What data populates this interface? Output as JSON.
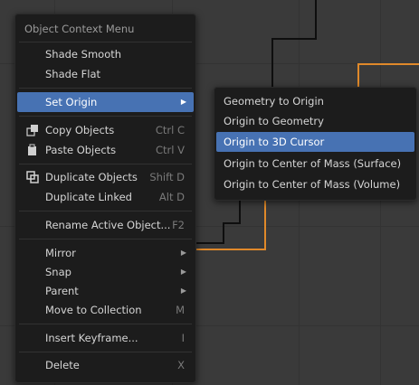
{
  "colors": {
    "menu_background": "#1c1c1c",
    "highlight": "#4772b3",
    "text": "#d5d5d5",
    "shortcut_text": "#7a7a7a",
    "selection_outline": "#e0892a"
  },
  "context_menu": {
    "title": "Object Context Menu",
    "items": {
      "shade_smooth": {
        "label": "Shade Smooth"
      },
      "shade_flat": {
        "label": "Shade Flat"
      },
      "set_origin": {
        "label": "Set Origin",
        "submenu": true
      },
      "copy_objects": {
        "label": "Copy Objects",
        "shortcut": "Ctrl C",
        "icon": "copy-icon"
      },
      "paste_objects": {
        "label": "Paste Objects",
        "shortcut": "Ctrl V",
        "icon": "paste-icon"
      },
      "duplicate_objects": {
        "label": "Duplicate Objects",
        "shortcut": "Shift D",
        "icon": "duplicate-icon"
      },
      "duplicate_linked": {
        "label": "Duplicate Linked",
        "shortcut": "Alt D"
      },
      "rename_active_object": {
        "label": "Rename Active Object...",
        "shortcut": "F2"
      },
      "mirror": {
        "label": "Mirror",
        "submenu": true
      },
      "snap": {
        "label": "Snap",
        "submenu": true
      },
      "parent": {
        "label": "Parent",
        "submenu": true
      },
      "move_to_collection": {
        "label": "Move to Collection",
        "shortcut": "M"
      },
      "insert_keyframe": {
        "label": "Insert Keyframe...",
        "shortcut": "I"
      },
      "delete": {
        "label": "Delete",
        "shortcut": "X"
      }
    }
  },
  "set_origin_submenu": {
    "items": {
      "geometry_to_origin": {
        "label": "Geometry to Origin"
      },
      "origin_to_geometry": {
        "label": "Origin to Geometry"
      },
      "origin_to_3d_cursor": {
        "label": "Origin to 3D Cursor"
      },
      "origin_to_center_of_mass_surface": {
        "label": "Origin to Center of Mass (Surface)"
      },
      "origin_to_center_of_mass_volume": {
        "label": "Origin to Center of Mass (Volume)"
      }
    }
  },
  "glyphs": {
    "submenu_arrow": "▶"
  }
}
